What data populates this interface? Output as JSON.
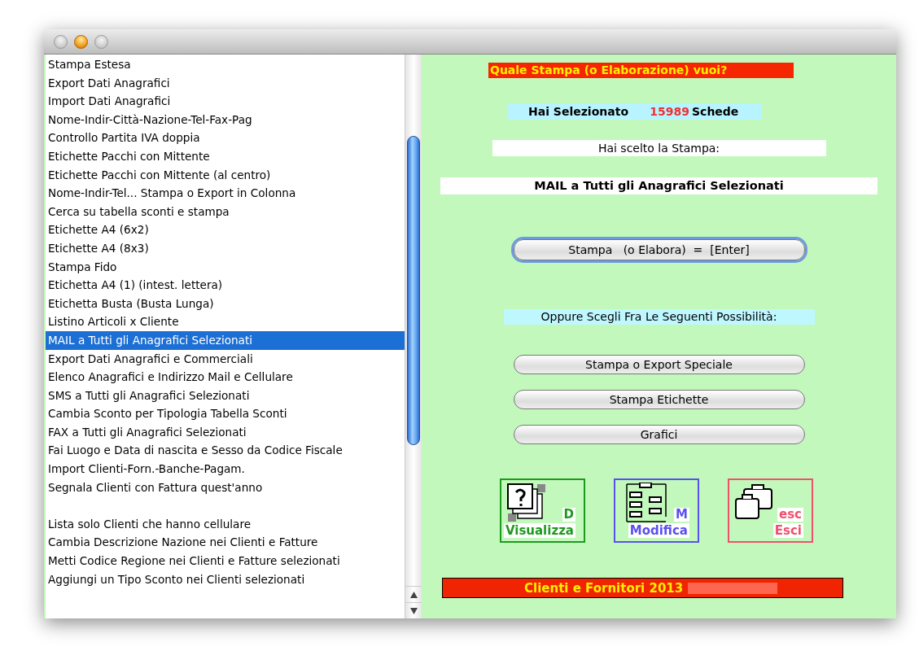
{
  "window": {
    "controls": [
      {
        "active": false
      },
      {
        "active": true
      },
      {
        "active": false
      }
    ]
  },
  "list": {
    "items": [
      {
        "kind": "option",
        "label": "Stampa Estesa",
        "selected": false
      },
      {
        "kind": "option",
        "label": "Export Dati Anagrafici",
        "selected": false
      },
      {
        "kind": "option",
        "label": "Import Dati Anagrafici",
        "selected": false
      },
      {
        "kind": "option",
        "label": "Nome-Indir-Città-Nazione-Tel-Fax-Pag",
        "selected": false
      },
      {
        "kind": "option",
        "label": "Controllo Partita IVA doppia",
        "selected": false
      },
      {
        "kind": "option",
        "label": "Etichette Pacchi con Mittente",
        "selected": false
      },
      {
        "kind": "option",
        "label": "Etichette Pacchi con Mittente (al centro)",
        "selected": false
      },
      {
        "kind": "option",
        "label": "Nome-Indir-Tel... Stampa o Export in Colonna",
        "selected": false
      },
      {
        "kind": "option",
        "label": "Cerca su tabella sconti e stampa",
        "selected": false
      },
      {
        "kind": "option",
        "label": "Etichette A4 (6x2)",
        "selected": false
      },
      {
        "kind": "option",
        "label": "Etichette A4 (8x3)",
        "selected": false
      },
      {
        "kind": "option",
        "label": "Stampa Fido",
        "selected": false
      },
      {
        "kind": "option",
        "label": "Etichetta A4 (1) (intest. lettera)",
        "selected": false
      },
      {
        "kind": "option",
        "label": "Etichetta Busta (Busta Lunga)",
        "selected": false
      },
      {
        "kind": "option",
        "label": "Listino Articoli x Cliente",
        "selected": false
      },
      {
        "kind": "option",
        "label": "MAIL a Tutti gli Anagrafici Selezionati",
        "selected": true
      },
      {
        "kind": "option",
        "label": "Export Dati Anagrafici e Commerciali",
        "selected": false
      },
      {
        "kind": "option",
        "label": "Elenco Anagrafici e Indirizzo Mail e Cellulare",
        "selected": false
      },
      {
        "kind": "option",
        "label": "SMS a Tutti gli Anagrafici Selezionati",
        "selected": false
      },
      {
        "kind": "option",
        "label": "Cambia Sconto per Tipologia Tabella Sconti",
        "selected": false
      },
      {
        "kind": "option",
        "label": "FAX a Tutti gli Anagrafici Selezionati",
        "selected": false
      },
      {
        "kind": "option",
        "label": "Fai Luogo e Data di nascita e Sesso da Codice Fiscale",
        "selected": false
      },
      {
        "kind": "option",
        "label": "Import Clienti-Forn.-Banche-Pagam.",
        "selected": false
      },
      {
        "kind": "option",
        "label": "Segnala Clienti con Fattura quest'anno",
        "selected": false
      },
      {
        "kind": "blank"
      },
      {
        "kind": "option",
        "label": "Lista solo Clienti che hanno cellulare",
        "selected": false
      },
      {
        "kind": "option",
        "label": "Cambia Descrizione Nazione nei Clienti e Fatture",
        "selected": false
      },
      {
        "kind": "option",
        "label": "Metti Codice Regione nei Clienti e Fatture selezionati",
        "selected": false
      },
      {
        "kind": "option",
        "label": "Aggiungi un Tipo Sconto nei Clienti selezionati",
        "selected": false
      }
    ]
  },
  "panel": {
    "question": "Quale Stampa (o Elaborazione) vuoi?",
    "selected_label": "Hai Selezionato",
    "selected_count": "15989",
    "selected_unit": "Schede",
    "chosen_label": "Hai scelto la Stampa:",
    "chosen_value": "MAIL a Tutti gli Anagrafici Selezionati",
    "main_button": "Stampa   (o Elabora)  =  [Enter]",
    "alternatives_label": "Oppure Scegli Fra Le Seguenti Possibilità:",
    "buttons": [
      "Stampa o Export Speciale",
      "Stampa Etichette",
      "Grafici"
    ],
    "icon_buttons": [
      {
        "kind": "view",
        "key": "D",
        "label": "Visualizza",
        "color": "#1e9a1e"
      },
      {
        "kind": "edit",
        "key": "M",
        "label": "Modifica",
        "color": "#5a50f0"
      },
      {
        "kind": "exit",
        "key": "esc",
        "label": "Esci",
        "color": "#f0506e"
      }
    ],
    "footer": "Clienti e Fornitori 2013"
  }
}
